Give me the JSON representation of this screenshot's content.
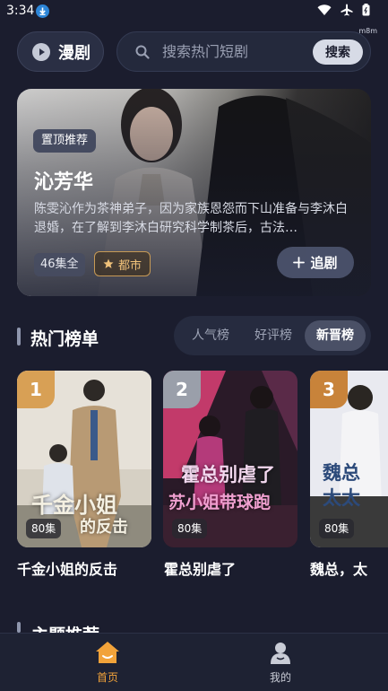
{
  "status": {
    "time": "3:34",
    "carrier_tag": "m8m"
  },
  "header": {
    "brand_label": "漫剧",
    "search_placeholder": "搜索热门短剧",
    "search_button": "搜索"
  },
  "hero": {
    "tag": "置顶推荐",
    "title": "沁芳华",
    "description": "陈雯沁作为茶神弟子，因为家族恩怨而下山准备与李沐白退婚，在了解到李沐白研究科学制茶后，古法…",
    "episodes": "46集全",
    "genre": "都市",
    "follow_button": "追剧"
  },
  "ranking": {
    "title": "热门榜单",
    "tabs": [
      "人气榜",
      "好评榜",
      "新晋榜"
    ],
    "active_tab": "新晋榜",
    "items": [
      {
        "rank": "1",
        "title": "千金小姐的反击",
        "episodes": "80集",
        "rank_color": "#d8a055",
        "poster_text_a": "千金小姐",
        "poster_text_b": "的反击"
      },
      {
        "rank": "2",
        "title": "霍总别虐了",
        "episodes": "80集",
        "rank_color": "#9a9faa",
        "poster_text_a": "霍总别虐了",
        "poster_text_b": "苏小姐带球跑"
      },
      {
        "rank": "3",
        "title": "魏总，太",
        "episodes": "80集",
        "rank_color": "#c8833a",
        "poster_text_a": "魏总",
        "poster_text_b": "太太"
      }
    ]
  },
  "next_section": {
    "title": "主题推荐"
  },
  "nav": {
    "home": "首页",
    "mine": "我的",
    "active_color": "#f2a33a"
  }
}
